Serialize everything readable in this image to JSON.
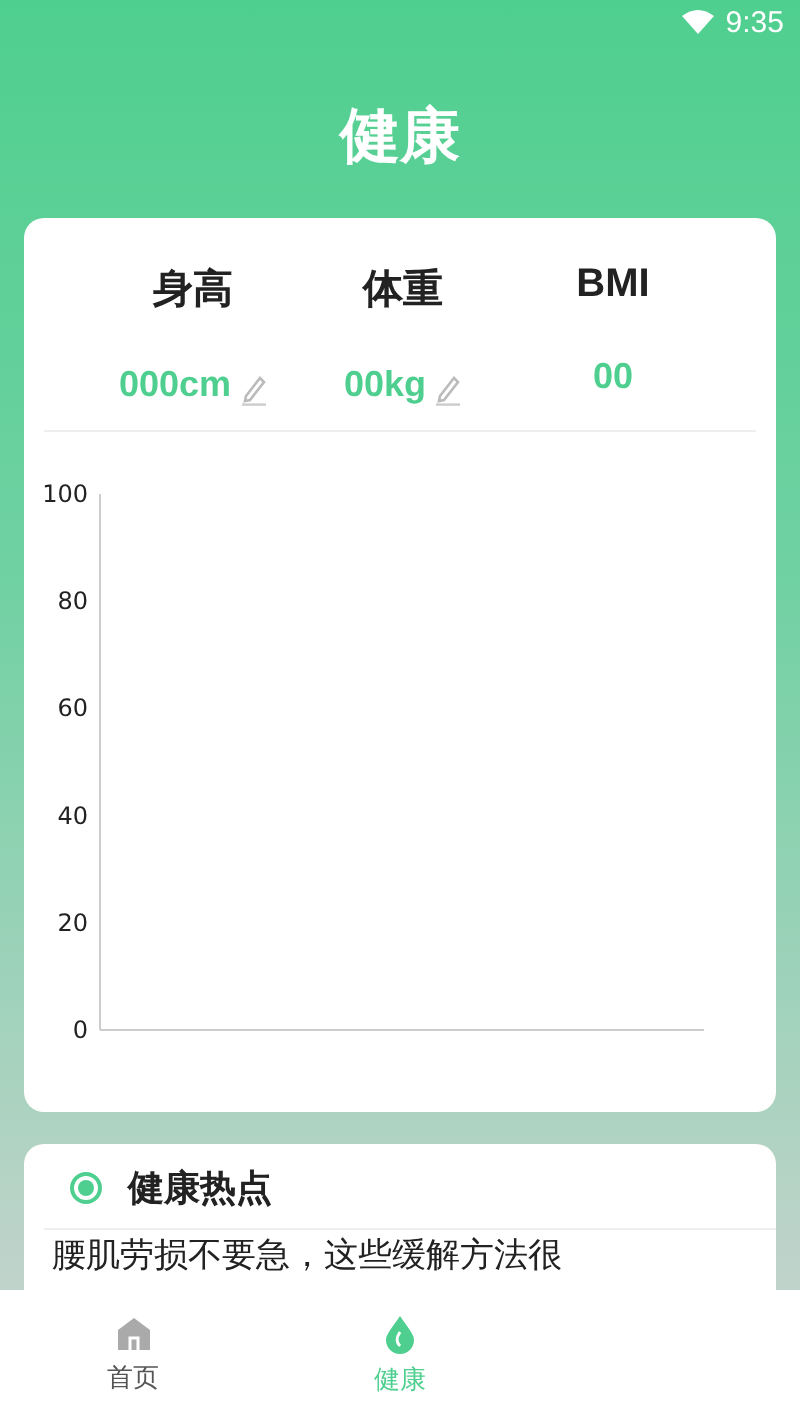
{
  "status_bar": {
    "time": "9:35"
  },
  "title": "健康",
  "metrics": [
    {
      "label": "身高",
      "value": "000cm",
      "editable": true
    },
    {
      "label": "体重",
      "value": "00kg",
      "editable": true
    },
    {
      "label": "BMI",
      "value": "00",
      "editable": false
    }
  ],
  "chart_data": {
    "type": "line",
    "categories": [
      null
    ],
    "series": [
      {
        "values": [
          null
        ]
      }
    ],
    "ylim": [
      0,
      100
    ],
    "yticks": [
      0,
      20,
      40,
      60,
      80,
      100
    ]
  },
  "hot_topics": {
    "title": "健康热点",
    "articles": [
      "腰肌劳损不要急，这些缓解方法很"
    ]
  },
  "nav": [
    {
      "label": "首页",
      "kind": "home",
      "selected": false
    },
    {
      "label": "健康",
      "kind": "health",
      "selected": true
    }
  ]
}
